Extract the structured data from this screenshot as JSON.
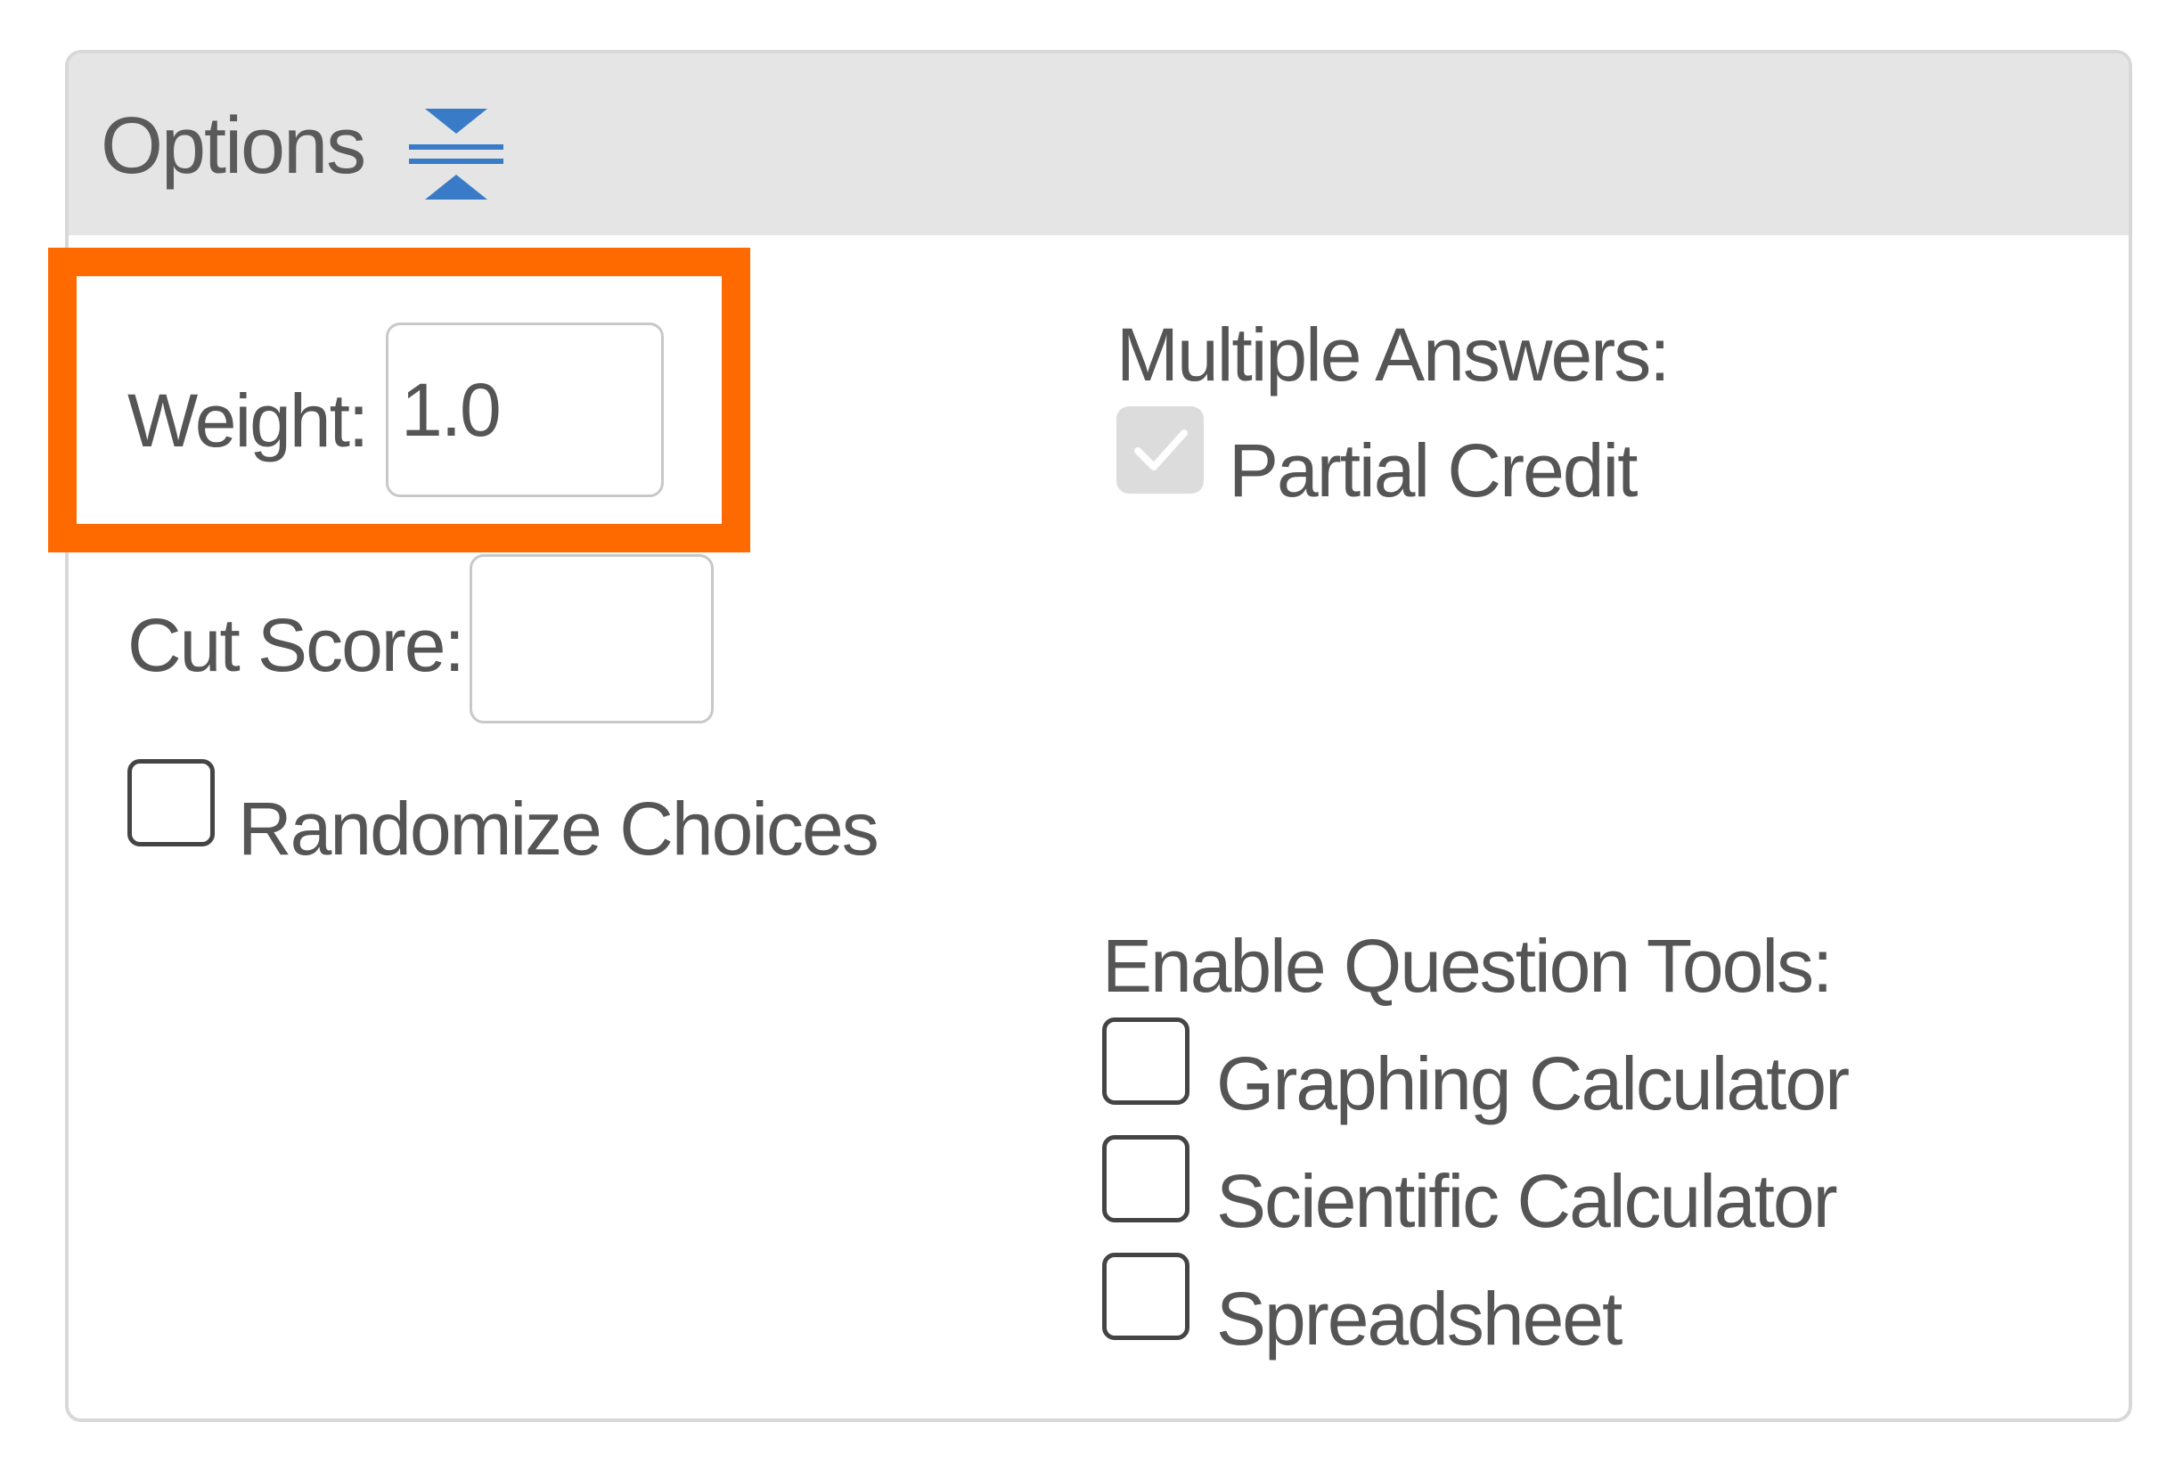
{
  "options_panel": {
    "title": "Options",
    "collapse_icon": "collapse-vertical-icon"
  },
  "weight": {
    "label": "Weight:",
    "value": "1.0"
  },
  "cut_score": {
    "label": "Cut Score:",
    "value": ""
  },
  "randomize_choices": {
    "label": "Randomize Choices",
    "checked": false
  },
  "multiple_answers": {
    "heading": "Multiple Answers:",
    "partial_credit": {
      "label": "Partial Credit",
      "checked": true,
      "disabled": true
    }
  },
  "question_tools": {
    "heading": "Enable Question Tools:",
    "items": [
      {
        "label": "Graphing Calculator",
        "checked": false
      },
      {
        "label": "Scientific Calculator",
        "checked": false
      },
      {
        "label": "Spreadsheet",
        "checked": false
      }
    ]
  },
  "colors": {
    "highlight": "#ff6a00",
    "icon_blue": "#3a7bc8",
    "header_bg": "#e5e5e5",
    "text": "#555555"
  }
}
